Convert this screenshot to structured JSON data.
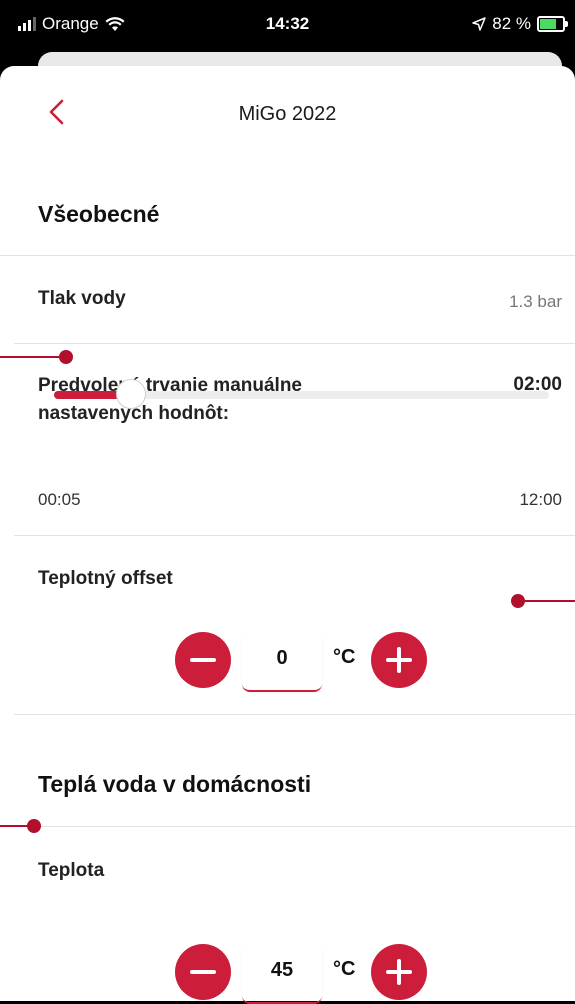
{
  "status_bar": {
    "carrier": "Orange",
    "time": "14:32",
    "battery_percent": "82 %",
    "battery_level": 0.82
  },
  "nav": {
    "title": "MiGo 2022"
  },
  "general": {
    "section_title": "Všeobecné",
    "water_pressure": {
      "label": "Tlak vody",
      "value": "1.3 bar"
    },
    "default_duration": {
      "label_line1": "Predvolené trvanie manuálne",
      "label_line2": "nastavených hodnôt:",
      "value": "02:00",
      "min_label": "00:05",
      "max_label": "12:00",
      "slider_fraction": 0.155
    },
    "temp_offset": {
      "label": "Teplotný offset",
      "value": "0",
      "unit": "°C"
    }
  },
  "hot_water": {
    "section_title": "Teplá voda v domácnosti",
    "temperature": {
      "label": "Teplota",
      "value": "45",
      "unit": "°C"
    }
  },
  "colors": {
    "accent": "#cc1e3a",
    "annotation": "#b0102c"
  },
  "icons": {
    "back": "chevron-left-icon",
    "minus": "minus-circle-icon",
    "plus": "plus-circle-icon",
    "wifi": "wifi-icon",
    "location": "location-arrow-icon",
    "battery": "battery-charging-icon"
  }
}
